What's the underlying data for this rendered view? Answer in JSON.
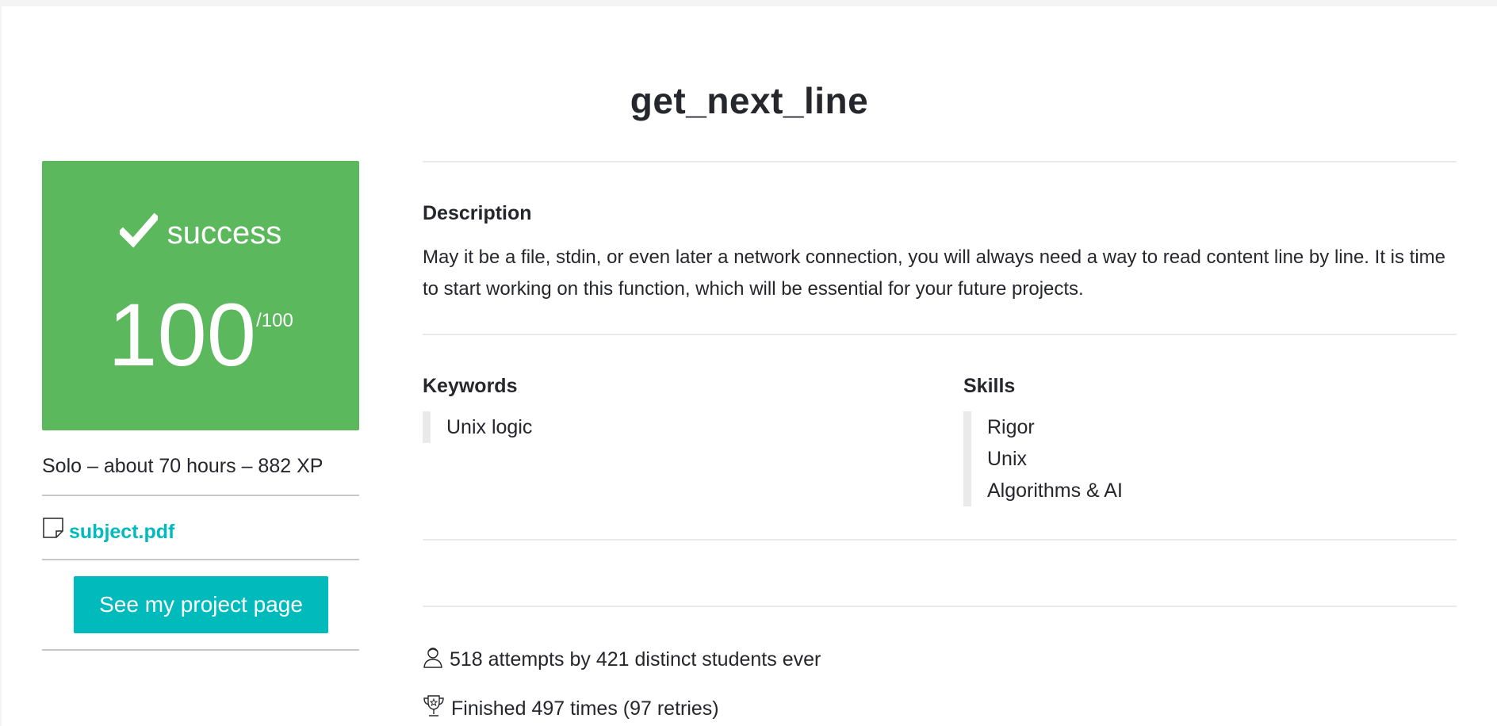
{
  "project": {
    "title": "get_next_line"
  },
  "score_panel": {
    "status": "success",
    "score": "100",
    "max": "/100",
    "background_color": "#5cb85c"
  },
  "meta": {
    "line": "Solo – about 70 hours – 882 XP"
  },
  "attachment": {
    "icon": "document-icon",
    "label": "subject.pdf",
    "color": "#00babc"
  },
  "actions": {
    "project_page_label": "See my project page",
    "button_color": "#00babc"
  },
  "description": {
    "heading": "Description",
    "text": "May it be a file, stdin, or even later a network connection, you will always need a way to read content line by line. It is time to start working on this function, which will be essential for your future projects."
  },
  "keywords": {
    "heading": "Keywords",
    "items": [
      "Unix logic"
    ]
  },
  "skills": {
    "heading": "Skills",
    "items": [
      "Rigor",
      "Unix",
      "Algorithms & AI"
    ]
  },
  "stats": {
    "attempts": {
      "icon": "user-icon",
      "text": "518 attempts by 421 distinct students ever"
    },
    "finished": {
      "icon": "trophy-icon",
      "text": "Finished 497 times (97 retries)"
    }
  }
}
